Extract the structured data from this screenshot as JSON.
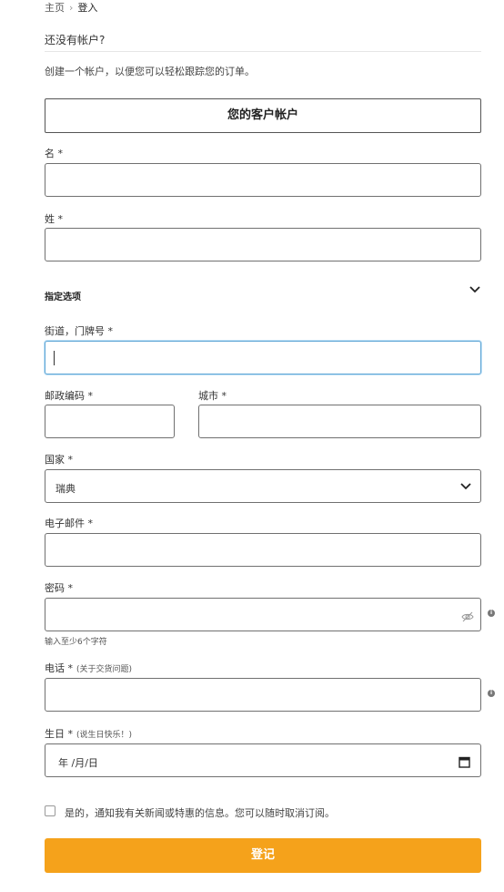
{
  "breadcrumb": {
    "home": "主页",
    "separator": "›",
    "current": "登入"
  },
  "section_title": "还没有帐户?",
  "intro_text": "创建一个帐户，以便您可以轻松跟踪您的订单。",
  "account_button_label": "您的客户帐户",
  "fields": {
    "first_name": {
      "label": "名 *",
      "value": ""
    },
    "last_name": {
      "label": "姓 *",
      "value": ""
    },
    "options": {
      "label": "指定选项"
    },
    "street": {
      "label": "街道，门牌号 *",
      "value": ""
    },
    "postal": {
      "label": "邮政编码 *",
      "value": ""
    },
    "city": {
      "label": "城市 *",
      "value": ""
    },
    "country": {
      "label": "国家 *",
      "value": "瑞典"
    },
    "email": {
      "label": "电子邮件 *",
      "value": ""
    },
    "password": {
      "label": "密码 *",
      "value": "",
      "hint": "输入至少6个字符"
    },
    "phone": {
      "label": "电话 *",
      "note": "(关于交货问题)",
      "value": ""
    },
    "birthday": {
      "label": "生日 *",
      "note": "(说生日快乐！)",
      "placeholder": "年 /月/日"
    }
  },
  "newsletter_label": "是的，通知我有关新闻或特惠的信息。您可以随时取消订阅。",
  "newsletter_checked": false,
  "submit_label": "登记",
  "colors": {
    "accent": "#f5a21b",
    "focus_border": "#5fa6d6",
    "input_border": "#707070"
  },
  "icons": {
    "dropdown": "chevron-down-icon",
    "password_visibility": "eye-slash-icon",
    "info": "info-icon",
    "calendar": "calendar-icon"
  }
}
